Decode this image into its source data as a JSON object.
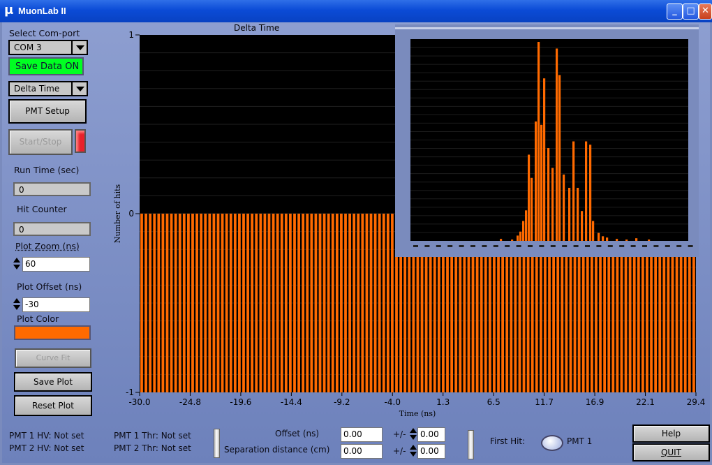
{
  "window": {
    "title": "MuonLab II",
    "icon_glyph": "μ"
  },
  "sidebar": {
    "com_label": "Select Com-port",
    "com_value": "COM 3",
    "save_data": "Save Data ON",
    "plot_mode": "Delta Time",
    "pmt_setup": "PMT Setup",
    "start_stop": "Start/Stop",
    "run_time_label": "Run Time (sec)",
    "run_time_value": "0",
    "hit_counter_label": "Hit Counter",
    "hit_counter_value": "0",
    "plot_zoom_label": "Plot Zoom (ns)",
    "plot_zoom_value": "60",
    "plot_offset_label": "Plot Offset (ns)",
    "plot_offset_value": "-30",
    "plot_color_label": "Plot Color",
    "curve_fit": "Curve Fit",
    "save_plot": "Save Plot",
    "reset_plot": "Reset Plot"
  },
  "colors": {
    "plot": "#ff6a00",
    "save_data_bg": "#00ff22",
    "led": "#e8202a",
    "plot_bg": "#000000"
  },
  "chart_data": {
    "type": "bar",
    "title": "Delta Time",
    "xlabel": "Time (ns)",
    "ylabel": "Number of hits",
    "xlim": [
      -30.0,
      29.4
    ],
    "ylim": [
      -1,
      1
    ],
    "x_ticks": [
      "-30.0",
      "-24.8",
      "-19.6",
      "-14.4",
      "-9.2",
      "-4.0",
      "1.3",
      "6.5",
      "11.7",
      "16.9",
      "22.1",
      "29.4"
    ],
    "y_ticks": [
      "1",
      "0",
      "-1"
    ],
    "bar_count": 131,
    "bar_value": -1
  },
  "bottom": {
    "pmt1_hv": "PMT 1 HV: Not set",
    "pmt2_hv": "PMT 2 HV: Not set",
    "pmt1_thr": "PMT 1 Thr: Not set",
    "pmt2_thr": "PMT 2 Thr: Not set",
    "offset_label": "Offset (ns)",
    "offset_value": "0.00",
    "sep_label": "Separation distance (cm)",
    "sep_value": "0.00",
    "pm1": "+/-",
    "pm2": "+/-",
    "pm1_value": "0.00",
    "pm2_value": "0.00",
    "first_hit_label": "First Hit:",
    "first_hit_value": "PMT 1",
    "help": "Help",
    "quit": "QUIT"
  }
}
